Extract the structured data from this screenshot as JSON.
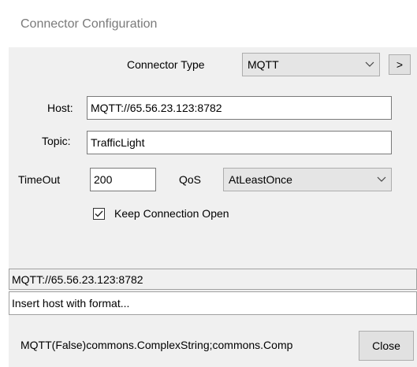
{
  "window": {
    "title": "Connector Configuration"
  },
  "connector": {
    "type_label": "Connector Type",
    "type_value": "MQTT",
    "next_button": ">"
  },
  "fields": {
    "host_label": "Host:",
    "host_value": "MQTT://65.56.23.123:8782",
    "topic_label": "Topic:",
    "topic_value": "TrafficLight",
    "timeout_label": "TimeOut",
    "timeout_value": "200",
    "qos_label": "QoS",
    "qos_value": "AtLeastOnce"
  },
  "keep_open": {
    "label": "Keep Connection Open",
    "checked": true
  },
  "status": {
    "host_display": "MQTT://65.56.23.123:8782",
    "hint": "Insert host with format...",
    "summary": "MQTT(False)commons.ComplexString;commons.Comp"
  },
  "close_button": "Close",
  "icons": {
    "dropdown": "chevron-down-icon",
    "check": "check-icon"
  }
}
